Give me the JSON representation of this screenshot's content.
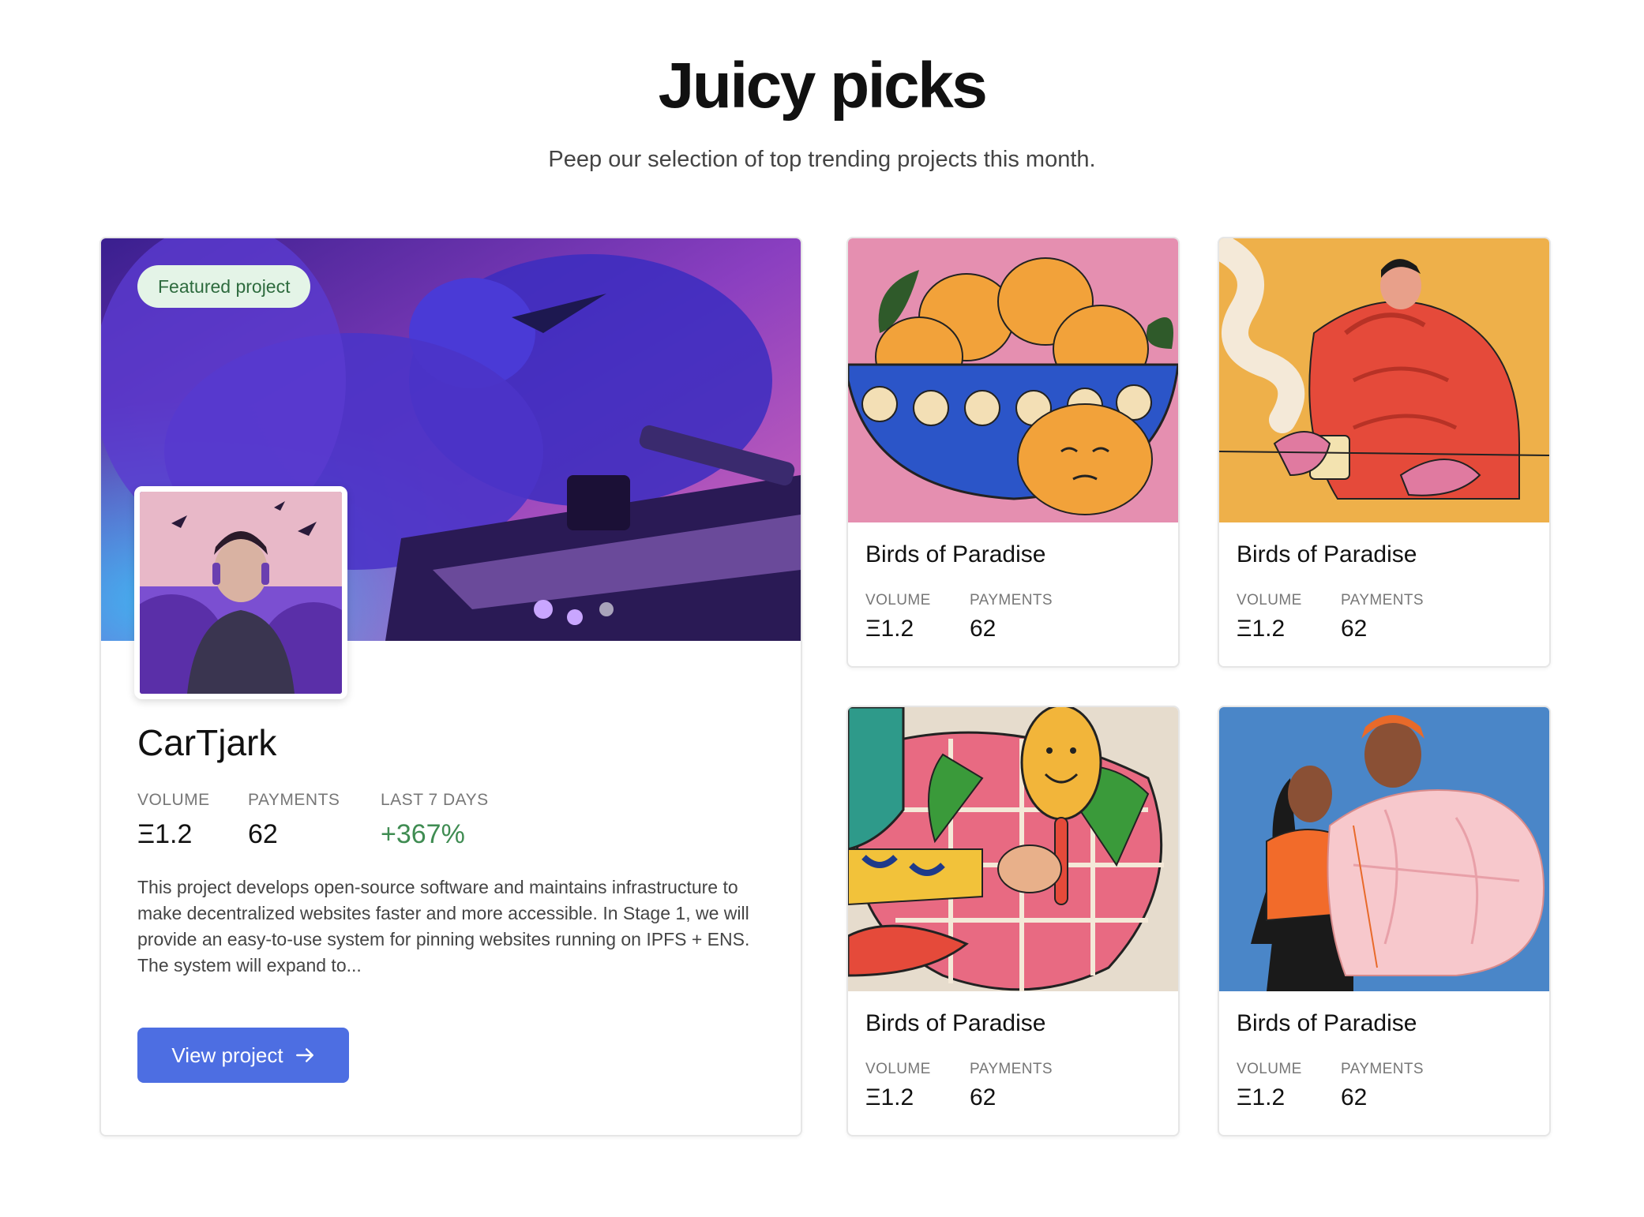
{
  "header": {
    "title": "Juicy picks",
    "subtitle": "Peep our selection of top trending projects this month."
  },
  "featured": {
    "badge": "Featured project",
    "name": "CarTjark",
    "stats": {
      "volume_label": "VOLUME",
      "volume_value": "Ξ1.2",
      "payments_label": "PAYMENTS",
      "payments_value": "62",
      "last7_label": "LAST 7 DAYS",
      "last7_value": "+367%"
    },
    "description": "This project develops open-source software and maintains infrastructure to make decentralized websites faster and more accessible. In Stage 1, we will provide an easy-to-use system for pinning websites running on IPFS + ENS. The system will expand to...",
    "button_label": "View project",
    "button_icon": "arrow-right-icon"
  },
  "projects": [
    {
      "title": "Birds of Paradise",
      "volume_label": "VOLUME",
      "volume_value": "Ξ1.2",
      "payments_label": "PAYMENTS",
      "payments_value": "62",
      "image": "lemons-bowl-illustration"
    },
    {
      "title": "Birds of Paradise",
      "volume_label": "VOLUME",
      "volume_value": "Ξ1.2",
      "payments_label": "PAYMENTS",
      "payments_value": "62",
      "image": "man-in-red-puffer-illustration"
    },
    {
      "title": "Birds of Paradise",
      "volume_label": "VOLUME",
      "volume_value": "Ξ1.2",
      "payments_label": "PAYMENTS",
      "payments_value": "62",
      "image": "hand-mirror-illustration"
    },
    {
      "title": "Birds of Paradise",
      "volume_label": "VOLUME",
      "volume_value": "Ξ1.2",
      "payments_label": "PAYMENTS",
      "payments_value": "62",
      "image": "couple-pink-coat-illustration"
    }
  ],
  "colors": {
    "button": "#4d6ee2",
    "badge_bg": "#e4f4e7",
    "badge_text": "#2e6b3e",
    "positive": "#3f8c52"
  }
}
